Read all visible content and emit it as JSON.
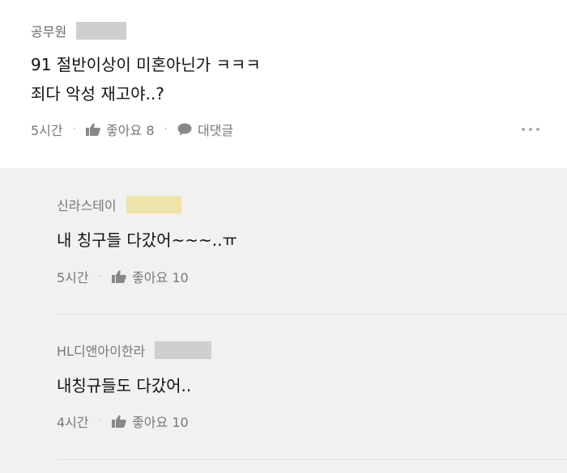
{
  "post": {
    "author": "공무원",
    "line1": "91 절반이상이 미혼아닌가 ㅋㅋㅋ",
    "line2": "죄다 악성 재고야..?",
    "time": "5시간",
    "like_label": "좋아요 8",
    "reply_label": "대댓글"
  },
  "replies": [
    {
      "author": "신라스테이",
      "text": "내 칭구들 다갔어~~~..ㅠ",
      "time": "5시간",
      "like_label": "좋아요 10"
    },
    {
      "author": "HL디앤아이한라",
      "text": "내칭규들도 다갔어..",
      "time": "4시간",
      "like_label": "좋아요 10"
    }
  ],
  "colors": {
    "redact_gray": "#cfcfcf",
    "redact_yellow": "#eee3a8",
    "reply_bg": "#f1f1f1"
  },
  "icons": [
    "thumbs-up-icon",
    "speech-bubble-icon",
    "more-dots-icon"
  ]
}
